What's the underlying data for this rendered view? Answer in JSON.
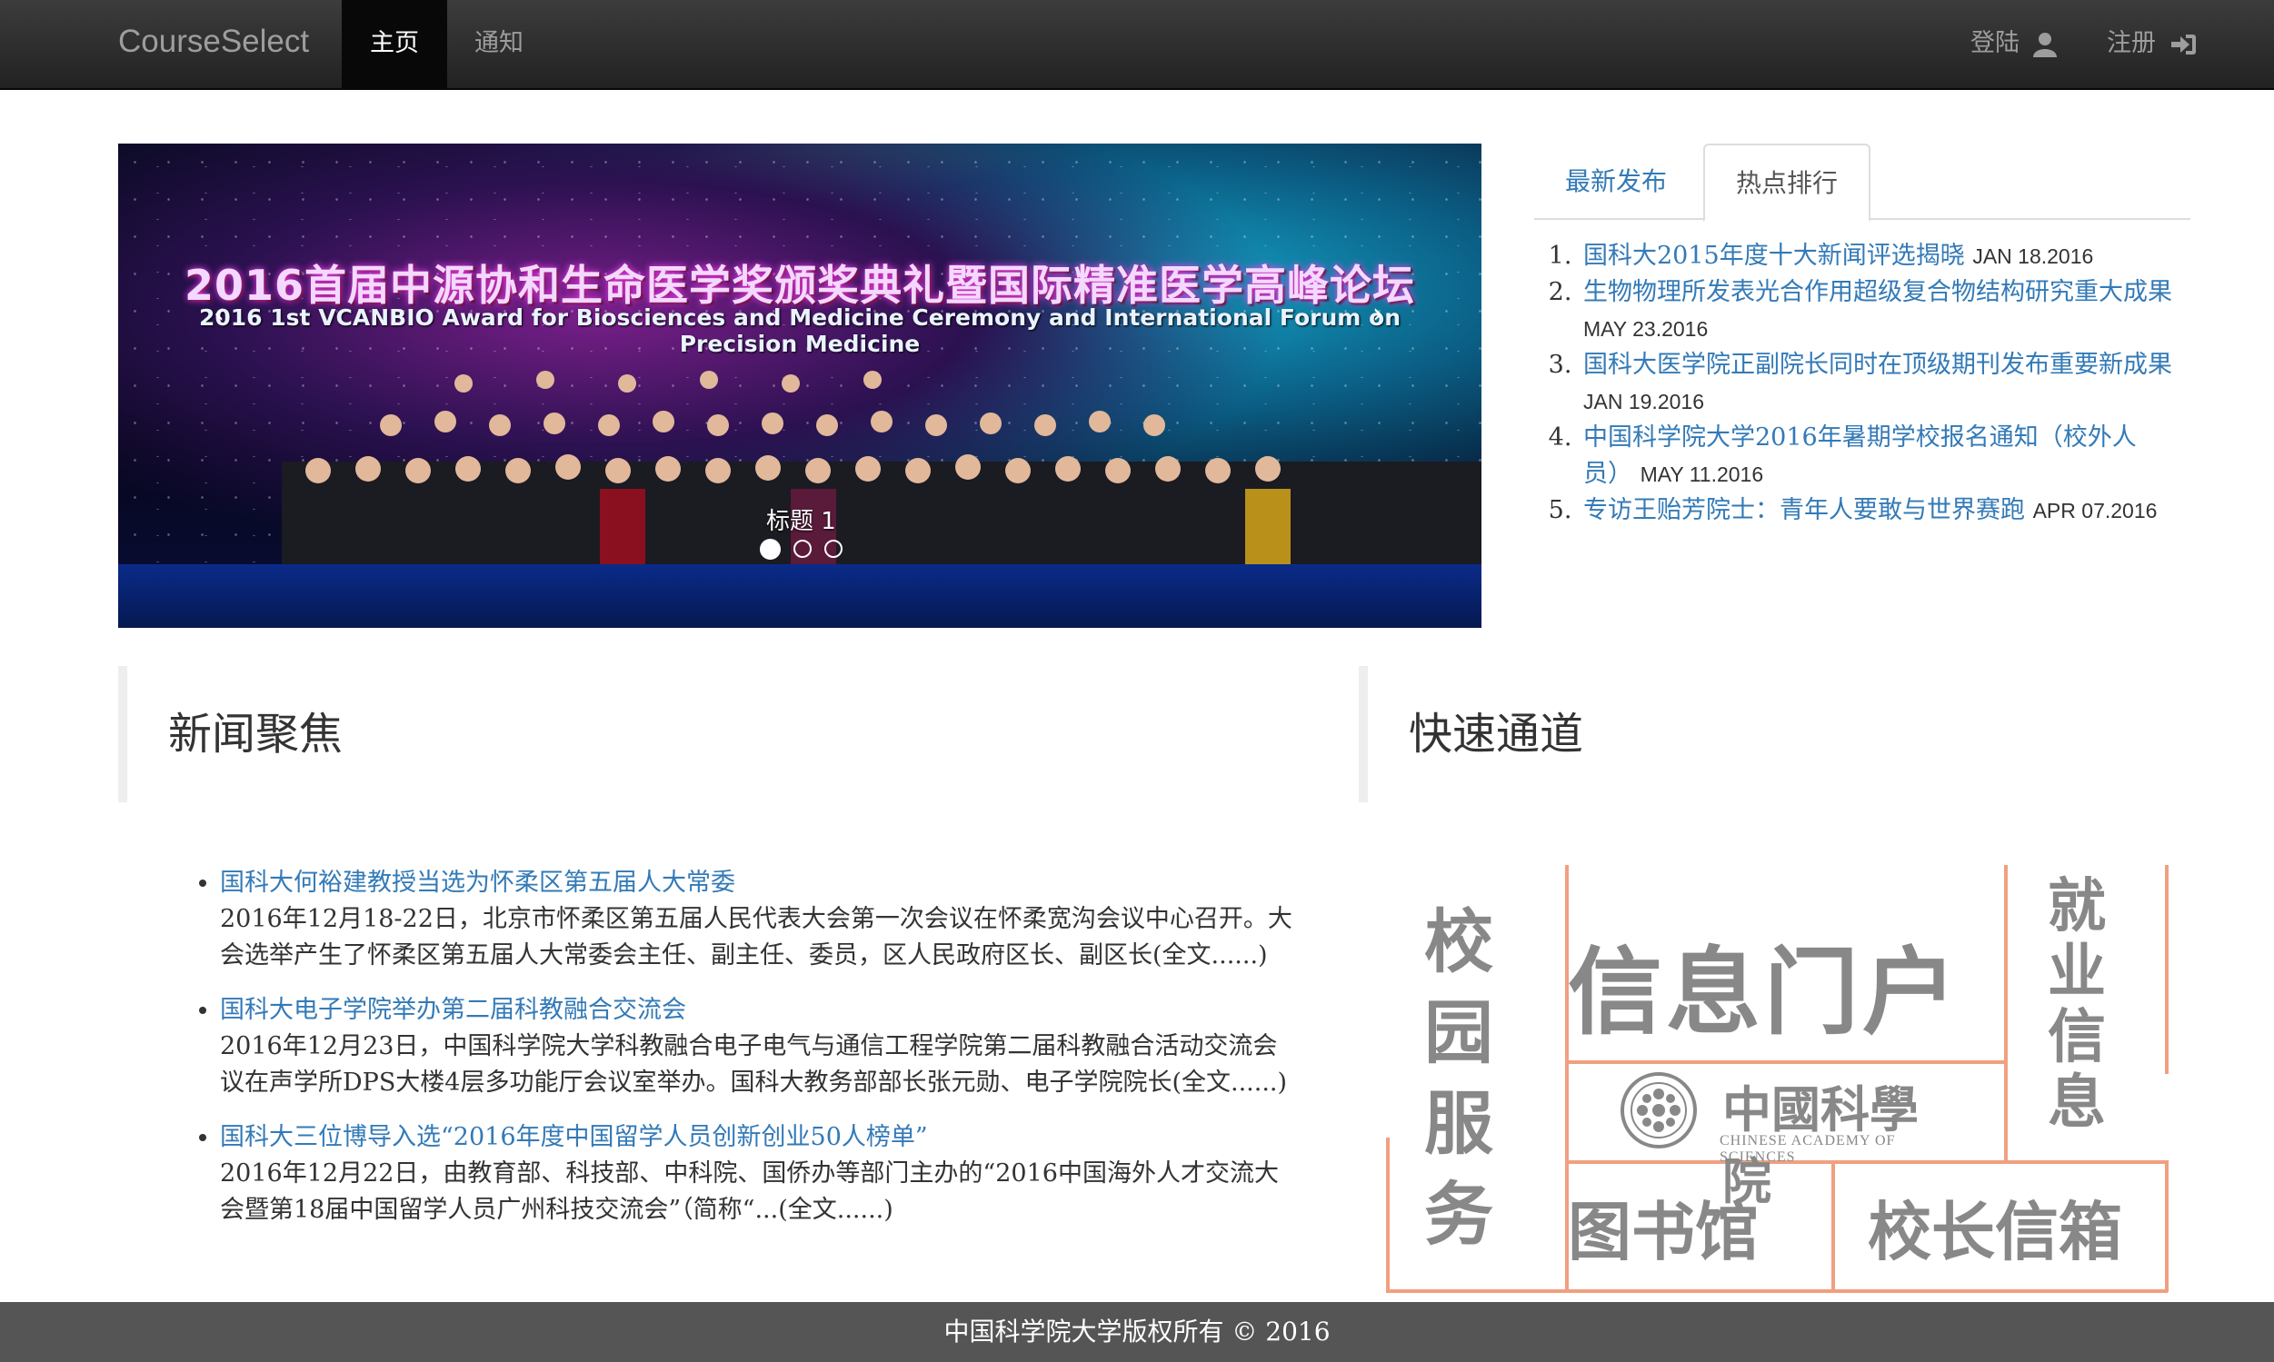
{
  "navbar": {
    "brand": "CourseSelect",
    "home": "主页",
    "notice": "通知",
    "login": "登陆",
    "register": "注册"
  },
  "carousel": {
    "banner_cn": "2016首届中源协和生命医学奖颁奖典礼暨国际精准医学高峰论坛",
    "banner_en": "2016 1st VCANBIO Award for Biosciences and Medicine Ceremony and International Forum on Precision Medicine",
    "caption": "标题 1",
    "prev": "‹",
    "next": "›",
    "active_slide": 1,
    "slide_count": 3
  },
  "tabs": {
    "latest": "最新发布",
    "hot": "热点排行",
    "active": "hot"
  },
  "hot_list": [
    {
      "title": "国科大2015年度十大新闻评选揭晓",
      "date": "JAN 18.2016"
    },
    {
      "title": "生物物理所发表光合作用超级复合物结构研究重大成果",
      "date": "MAY 23.2016"
    },
    {
      "title": "国科大医学院正副院长同时在顶级期刊发布重要新成果",
      "date": "JAN 19.2016"
    },
    {
      "title": "中国科学院大学2016年暑期学校报名通知（校外人员）",
      "date": "MAY 11.2016"
    },
    {
      "title": "专访王贻芳院士：青年人要敢与世界赛跑",
      "date": "APR 07.2016"
    }
  ],
  "news": {
    "heading": "新闻聚焦",
    "items": [
      {
        "title": "国科大何裕建教授当选为怀柔区第五届人大常委",
        "summary": "2016年12月18-22日，北京市怀柔区第五届人民代表大会第一次会议在怀柔宽沟会议中心召开。大会选举产生了怀柔区第五届人大常委会主任、副主任、委员，区人民政府区长、副区长(全文......)"
      },
      {
        "title": "国科大电子学院举办第二届科教融合交流会",
        "summary": "2016年12月23日，中国科学院大学科教融合电子电气与通信工程学院第二届科教融合活动交流会议在声学所DPS大楼4层多功能厅会议室举办。国科大教务部部长张元勋、电子学院院长(全文......)"
      },
      {
        "title": "国科大三位博导入选“2016年度中国留学人员创新创业50人榜单”",
        "summary": "2016年12月22日，由教育部、科技部、中科院、国侨办等部门主办的“2016中国海外人才交流大会暨第18届中国留学人员广州科技交流会”（简称“...(全文......)"
      }
    ]
  },
  "quick": {
    "heading": "快速通道",
    "campus": "校园服务",
    "portal": "信息门户",
    "career": "就业信息",
    "library": "图书馆",
    "mailbox": "校长信箱",
    "cas_cn": "中國科學院",
    "cas_en": "CHINESE ACADEMY OF SCIENCES"
  },
  "footer": "中国科学院大学版权所有 © 2016",
  "colors": {
    "link": "#337ab7",
    "navbar": "#222222",
    "footer": "#555555",
    "quick_border": "#f0a080"
  }
}
